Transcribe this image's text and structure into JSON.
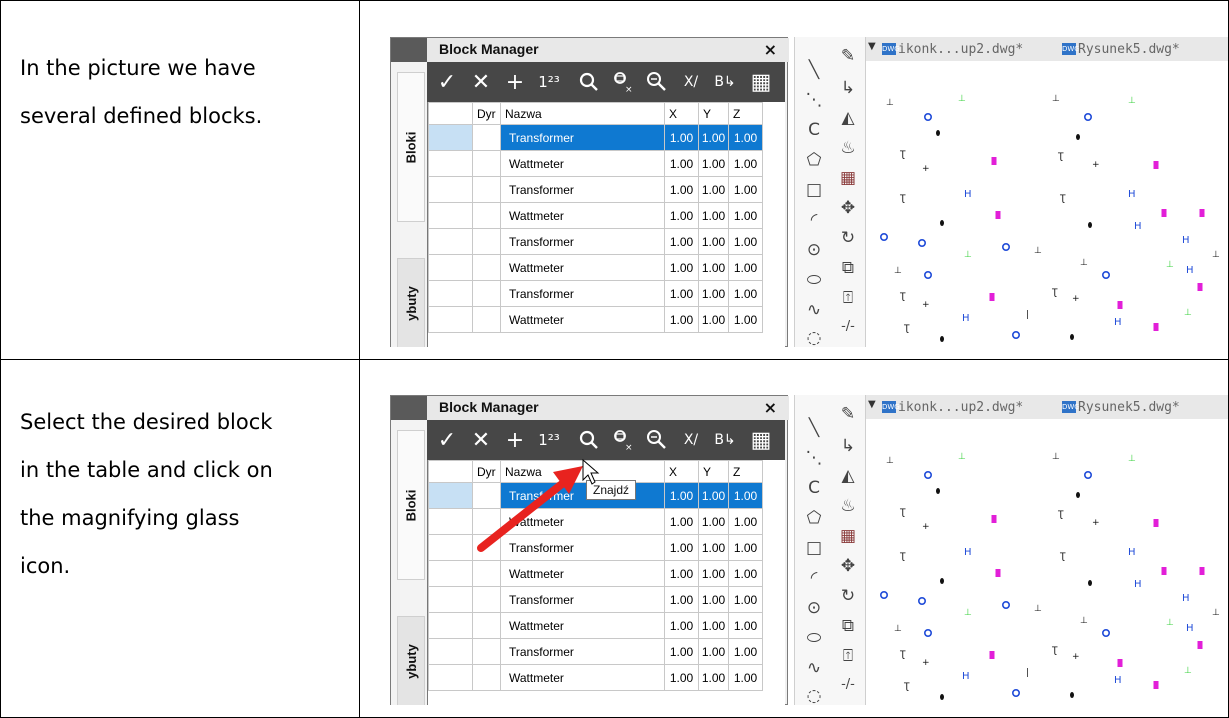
{
  "instructions": [
    {
      "lines": [
        "In the picture we have",
        "several defined blocks."
      ]
    },
    {
      "lines": [
        "Select the desired block",
        "in the table and click on",
        "the magnifying glass",
        "icon."
      ]
    }
  ],
  "block_manager": {
    "title": "Block Manager",
    "close": "×",
    "side_tabs": [
      "Bloki",
      "ybuty"
    ],
    "toolbar": {
      "apply": "✓",
      "delete": "✕",
      "add": "+",
      "numbering": "1²³",
      "find": "⚲",
      "filter": "⊞",
      "zoom": "🔍",
      "scale": "X/",
      "base": "B↳",
      "grid": "▦"
    },
    "columns": [
      "",
      "Dyr",
      "Nazwa",
      "X",
      "Y",
      "Z"
    ],
    "rows": [
      {
        "name": "Transformer",
        "x": "1.00",
        "y": "1.00",
        "z": "1.00",
        "selected": true
      },
      {
        "name": "Wattmeter",
        "x": "1.00",
        "y": "1.00",
        "z": "1.00",
        "selected": false
      },
      {
        "name": "Transformer",
        "x": "1.00",
        "y": "1.00",
        "z": "1.00",
        "selected": false
      },
      {
        "name": "Wattmeter",
        "x": "1.00",
        "y": "1.00",
        "z": "1.00",
        "selected": false
      },
      {
        "name": "Transformer",
        "x": "1.00",
        "y": "1.00",
        "z": "1.00",
        "selected": false
      },
      {
        "name": "Wattmeter",
        "x": "1.00",
        "y": "1.00",
        "z": "1.00",
        "selected": false
      },
      {
        "name": "Transformer",
        "x": "1.00",
        "y": "1.00",
        "z": "1.00",
        "selected": false
      },
      {
        "name": "Wattmeter",
        "x": "1.00",
        "y": "1.00",
        "z": "1.00",
        "selected": false
      }
    ],
    "tooltip": "Znajdź"
  },
  "drawing_tabs": [
    "ikonk...up2.dwg*",
    "Rysunek5.dwg*"
  ],
  "dwg_icon_text": "DWG",
  "tools_left": [
    "line-icon",
    "arc-icon",
    "polygon-icon",
    "rectangle-icon",
    "arc-tool-icon",
    "circle-icon",
    "cloud-icon",
    "spline-icon",
    "ellipse-icon",
    "ellipse-arc-icon"
  ],
  "tools_right": [
    "pencil-icon",
    "pointer-icon",
    "mirror-icon",
    "stamp-icon",
    "array-icon",
    "move-icon",
    "rotate-icon",
    "block-icon",
    "insert-icon",
    "dim-icon",
    "dash-icon"
  ],
  "colors": {
    "selection": "#0f79d1",
    "toolbar": "#474747",
    "arrow": "#e8231f",
    "magenta": "#e21fd8",
    "green": "#39d23d",
    "blue": "#1f4bd8"
  }
}
